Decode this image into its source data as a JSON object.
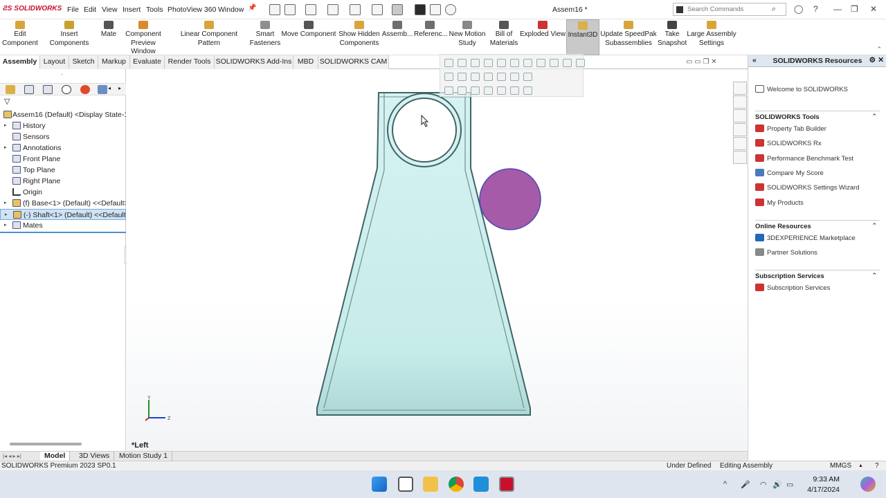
{
  "app": {
    "brand": "SOLIDWORKS",
    "document_title": "Assem16 *"
  },
  "menu": [
    "File",
    "Edit",
    "View",
    "Insert",
    "Tools",
    "PhotoView 360",
    "Window"
  ],
  "search": {
    "placeholder": "Search Commands"
  },
  "commands": [
    {
      "label": "Edit\nComponent",
      "icon": "edit-component-icon"
    },
    {
      "label": "Insert Components",
      "icon": "insert-components-icon"
    },
    {
      "label": "Mate",
      "icon": "mate-icon"
    },
    {
      "label": "Component\nPreview Window",
      "icon": "preview-window-icon"
    },
    {
      "label": "Linear Component Pattern",
      "icon": "linear-pattern-icon"
    },
    {
      "label": "Smart\nFasteners",
      "icon": "smart-fasteners-icon"
    },
    {
      "label": "Move Component",
      "icon": "move-component-icon"
    },
    {
      "label": "Show Hidden\nComponents",
      "icon": "show-hidden-icon"
    },
    {
      "label": "Assemb...",
      "icon": "assembly-features-icon"
    },
    {
      "label": "Referenc...",
      "icon": "reference-geometry-icon"
    },
    {
      "label": "New Motion\nStudy",
      "icon": "motion-study-icon"
    },
    {
      "label": "Bill of\nMaterials",
      "icon": "bom-icon"
    },
    {
      "label": "Exploded View",
      "icon": "exploded-view-icon"
    },
    {
      "label": "Instant3D",
      "icon": "instant3d-icon",
      "active": true
    },
    {
      "label": "Update SpeedPak\nSubassemblies",
      "icon": "speedpak-icon"
    },
    {
      "label": "Take\nSnapshot",
      "icon": "snapshot-icon"
    },
    {
      "label": "Large Assembly\nSettings",
      "icon": "large-assembly-icon"
    }
  ],
  "tabs": [
    "Assembly",
    "Layout",
    "Sketch",
    "Markup",
    "Evaluate",
    "Render Tools",
    "SOLIDWORKS Add-Ins",
    "MBD",
    "SOLIDWORKS CAM"
  ],
  "active_tab": "Assembly",
  "tree": [
    {
      "label": "Assem16 (Default) <Display State-1>",
      "expander": "",
      "icon": "assembly-icon"
    },
    {
      "label": "History",
      "expander": "▸",
      "icon": "history-icon"
    },
    {
      "label": "Sensors",
      "expander": "",
      "icon": "sensors-icon"
    },
    {
      "label": "Annotations",
      "expander": "▸",
      "icon": "annotations-icon"
    },
    {
      "label": "Front Plane",
      "expander": "",
      "icon": "plane-icon"
    },
    {
      "label": "Top Plane",
      "expander": "",
      "icon": "plane-icon"
    },
    {
      "label": "Right Plane",
      "expander": "",
      "icon": "plane-icon"
    },
    {
      "label": "Origin",
      "expander": "",
      "icon": "origin-icon"
    },
    {
      "label": "(f) Base<1> (Default) <<Default>",
      "expander": "▸",
      "icon": "part-icon"
    },
    {
      "label": "(-) Shaft<1> (Default) <<Default",
      "expander": "▸",
      "icon": "part-icon",
      "selected": true
    },
    {
      "label": "Mates",
      "expander": "▸",
      "icon": "mates-icon"
    }
  ],
  "viewport": {
    "view_label": "*Left",
    "triad_y": "Y",
    "triad_z": "Z"
  },
  "resources": {
    "title": "SOLIDWORKS Resources",
    "welcome": "Welcome to SOLIDWORKS",
    "sections": [
      {
        "title": "SOLIDWORKS Tools",
        "items": [
          "Property Tab Builder",
          "SOLIDWORKS Rx",
          "Performance Benchmark Test",
          "Compare My Score",
          "SOLIDWORKS Settings Wizard",
          "My Products"
        ]
      },
      {
        "title": "Online Resources",
        "items": [
          "3DEXPERIENCE Marketplace",
          "Partner Solutions"
        ]
      },
      {
        "title": "Subscription Services",
        "items": [
          "Subscription Services"
        ]
      }
    ]
  },
  "bottom_tabs": [
    "Model",
    "3D Views",
    "Motion Study 1"
  ],
  "status": {
    "version": "SOLIDWORKS Premium 2023 SP0.1",
    "state": "Under Defined",
    "mode": "Editing Assembly",
    "units": "MMGS"
  },
  "clock": {
    "time": "9:33 AM",
    "date": "4/17/2024"
  },
  "colors": {
    "brand_red": "#c8102e",
    "part_fill": "#cdeeee",
    "shaft_fill": "#a65ba8",
    "selection": "#cfe3f5"
  }
}
